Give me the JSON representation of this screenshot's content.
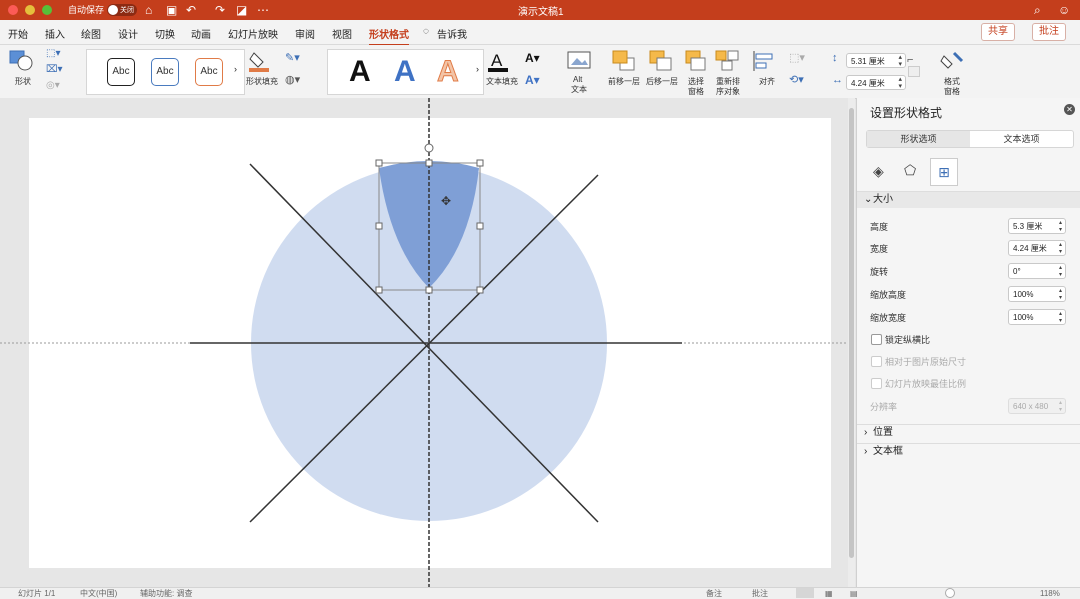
{
  "window": {
    "title": "演示文稿1",
    "autosave_label": "自动保存",
    "autosave_state": "关闭"
  },
  "menu": {
    "tabs": [
      "开始",
      "插入",
      "绘图",
      "设计",
      "切换",
      "动画",
      "幻灯片放映",
      "审阅",
      "视图",
      "形状格式"
    ],
    "active_tab": "形状格式",
    "tell_me": "告诉我",
    "share": "共享",
    "comments": "批注"
  },
  "ribbon": {
    "shapes_label": "形状",
    "style_samples": [
      "Abc",
      "Abc",
      "Abc"
    ],
    "shape_fill_label": "形状填充",
    "wordart_samples": [
      "A",
      "A",
      "A"
    ],
    "text_fill_label": "文本填充",
    "alt_text_label_1": "Alt",
    "alt_text_label_2": "文本",
    "bring_forward": "前移一层",
    "send_backward": "后移一层",
    "selection_pane_1": "选择",
    "selection_pane_2": "窗格",
    "reorder_1": "重新排",
    "reorder_2": "序对象",
    "align": "对齐",
    "height_value": "5.31 厘米",
    "width_value": "4.24 厘米",
    "format_pane_1": "格式",
    "format_pane_2": "窗格"
  },
  "panel": {
    "title": "设置形状格式",
    "tab_shape": "形状选项",
    "tab_text": "文本选项",
    "size_section": "大小",
    "height_label": "高度",
    "height_value": "5.3 厘米",
    "width_label": "宽度",
    "width_value": "4.24 厘米",
    "rotation_label": "旋转",
    "rotation_value": "0°",
    "scale_h_label": "缩放高度",
    "scale_h_value": "100%",
    "scale_w_label": "缩放宽度",
    "scale_w_value": "100%",
    "lock_aspect_label": "锁定纵横比",
    "relative_label": "相对于图片原始尺寸",
    "best_scale_label": "幻灯片放映最佳比例",
    "resolution_label": "分辨率",
    "resolution_value": "640 x 480",
    "position_section": "位置",
    "textbox_section": "文本框"
  },
  "status": {
    "slide": "幻灯片 1/1",
    "language": "中文(中国)",
    "accessibility": "辅助功能: 调查",
    "notes": "备注",
    "comments": "批注",
    "zoom": "118%"
  },
  "colors": {
    "brand": "#c43e1c",
    "circle": "#d0dcf0",
    "shield": "#7f9fd6"
  }
}
